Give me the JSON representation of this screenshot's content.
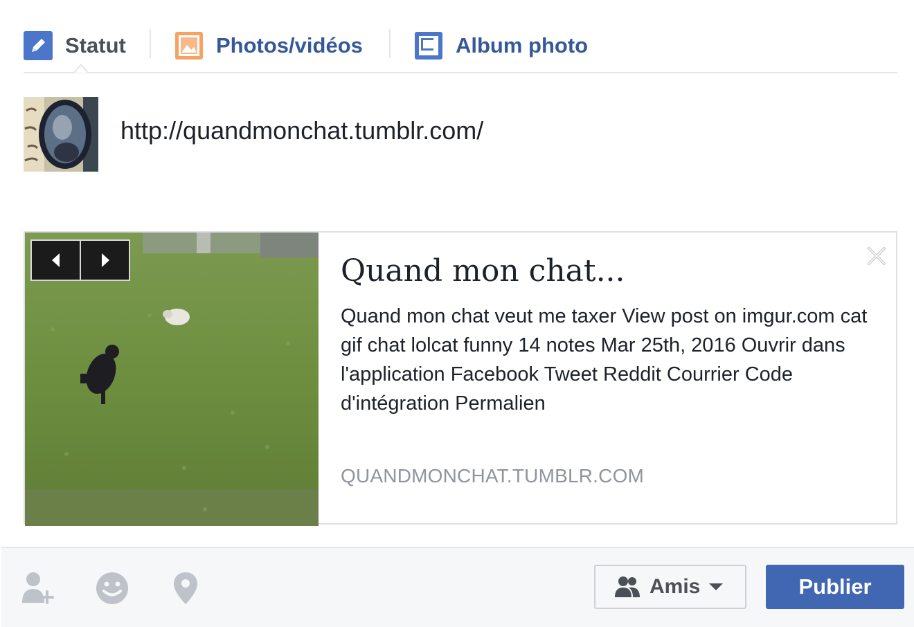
{
  "tabs": {
    "statut": {
      "label": "Statut",
      "icon": "pencil-icon"
    },
    "photos": {
      "label": "Photos/vidéos",
      "icon": "photo-icon"
    },
    "album": {
      "label": "Album photo",
      "icon": "album-icon"
    }
  },
  "composer": {
    "text": "http://quandmonchat.tumblr.com/"
  },
  "preview": {
    "title": "Quand mon chat...",
    "description": "Quand mon chat veut me taxer View post on imgur.com cat gif chat lolcat funny 14 notes Mar 25th, 2016 Ouvrir dans l'application Facebook Tweet Reddit Courrier Code d'intégration Permalien",
    "domain": "QUANDMONCHAT.TUMBLR.COM"
  },
  "footer": {
    "audience_label": "Amis",
    "publish_label": "Publier"
  },
  "colors": {
    "link_blue": "#365899",
    "button_blue": "#4267b2",
    "muted_text": "#90949c"
  }
}
